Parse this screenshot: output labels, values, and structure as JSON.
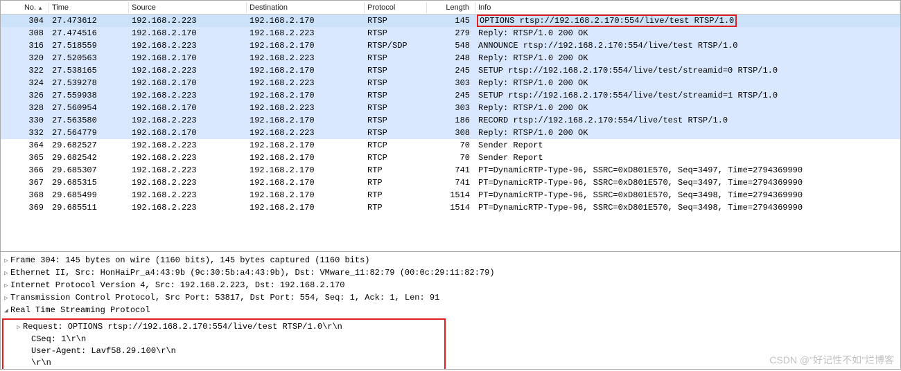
{
  "headers": {
    "no": "No.",
    "time": "Time",
    "source": "Source",
    "dest": "Destination",
    "proto": "Protocol",
    "len": "Length",
    "info": "Info"
  },
  "packets": [
    {
      "no": "304",
      "time": "27.473612",
      "src": "192.168.2.223",
      "dst": "192.168.2.170",
      "proto": "RTSP",
      "len": "145",
      "info": "OPTIONS rtsp://192.168.2.170:554/live/test RTSP/1.0",
      "selected": true,
      "boxed": true
    },
    {
      "no": "308",
      "time": "27.474516",
      "src": "192.168.2.170",
      "dst": "192.168.2.223",
      "proto": "RTSP",
      "len": "279",
      "info": "Reply: RTSP/1.0 200 OK"
    },
    {
      "no": "316",
      "time": "27.518559",
      "src": "192.168.2.223",
      "dst": "192.168.2.170",
      "proto": "RTSP/SDP",
      "len": "548",
      "info": "ANNOUNCE rtsp://192.168.2.170:554/live/test RTSP/1.0"
    },
    {
      "no": "320",
      "time": "27.520563",
      "src": "192.168.2.170",
      "dst": "192.168.2.223",
      "proto": "RTSP",
      "len": "248",
      "info": "Reply: RTSP/1.0 200 OK"
    },
    {
      "no": "322",
      "time": "27.538165",
      "src": "192.168.2.223",
      "dst": "192.168.2.170",
      "proto": "RTSP",
      "len": "245",
      "info": "SETUP rtsp://192.168.2.170:554/live/test/streamid=0 RTSP/1.0"
    },
    {
      "no": "324",
      "time": "27.539278",
      "src": "192.168.2.170",
      "dst": "192.168.2.223",
      "proto": "RTSP",
      "len": "303",
      "info": "Reply: RTSP/1.0 200 OK"
    },
    {
      "no": "326",
      "time": "27.559938",
      "src": "192.168.2.223",
      "dst": "192.168.2.170",
      "proto": "RTSP",
      "len": "245",
      "info": "SETUP rtsp://192.168.2.170:554/live/test/streamid=1 RTSP/1.0"
    },
    {
      "no": "328",
      "time": "27.560954",
      "src": "192.168.2.170",
      "dst": "192.168.2.223",
      "proto": "RTSP",
      "len": "303",
      "info": "Reply: RTSP/1.0 200 OK"
    },
    {
      "no": "330",
      "time": "27.563580",
      "src": "192.168.2.223",
      "dst": "192.168.2.170",
      "proto": "RTSP",
      "len": "186",
      "info": "RECORD rtsp://192.168.2.170:554/live/test RTSP/1.0"
    },
    {
      "no": "332",
      "time": "27.564779",
      "src": "192.168.2.170",
      "dst": "192.168.2.223",
      "proto": "RTSP",
      "len": "308",
      "info": "Reply: RTSP/1.0 200 OK"
    },
    {
      "no": "364",
      "time": "29.682527",
      "src": "192.168.2.223",
      "dst": "192.168.2.170",
      "proto": "RTCP",
      "len": "70",
      "info": "Sender Report"
    },
    {
      "no": "365",
      "time": "29.682542",
      "src": "192.168.2.223",
      "dst": "192.168.2.170",
      "proto": "RTCP",
      "len": "70",
      "info": "Sender Report"
    },
    {
      "no": "366",
      "time": "29.685307",
      "src": "192.168.2.223",
      "dst": "192.168.2.170",
      "proto": "RTP",
      "len": "741",
      "info": "PT=DynamicRTP-Type-96, SSRC=0xD801E570, Seq=3497, Time=2794369990"
    },
    {
      "no": "367",
      "time": "29.685315",
      "src": "192.168.2.223",
      "dst": "192.168.2.170",
      "proto": "RTP",
      "len": "741",
      "info": "PT=DynamicRTP-Type-96, SSRC=0xD801E570, Seq=3497, Time=2794369990"
    },
    {
      "no": "368",
      "time": "29.685499",
      "src": "192.168.2.223",
      "dst": "192.168.2.170",
      "proto": "RTP",
      "len": "1514",
      "info": "PT=DynamicRTP-Type-96, SSRC=0xD801E570, Seq=3498, Time=2794369990"
    },
    {
      "no": "369",
      "time": "29.685511",
      "src": "192.168.2.223",
      "dst": "192.168.2.170",
      "proto": "RTP",
      "len": "1514",
      "info": "PT=DynamicRTP-Type-96, SSRC=0xD801E570, Seq=3498, Time=2794369990"
    }
  ],
  "details": {
    "frame": "Frame 304: 145 bytes on wire (1160 bits), 145 bytes captured (1160 bits)",
    "eth": "Ethernet II, Src: HonHaiPr_a4:43:9b (9c:30:5b:a4:43:9b), Dst: VMware_11:82:79 (00:0c:29:11:82:79)",
    "ip": "Internet Protocol Version 4, Src: 192.168.2.223, Dst: 192.168.2.170",
    "tcp": "Transmission Control Protocol, Src Port: 53817, Dst Port: 554, Seq: 1, Ack: 1, Len: 91",
    "rtsp": "Real Time Streaming Protocol",
    "request": "Request: OPTIONS rtsp://192.168.2.170:554/live/test RTSP/1.0\\r\\n",
    "cseq": "CSeq: 1\\r\\n",
    "ua": "User-Agent: Lavf58.29.100\\r\\n",
    "crlf": "\\r\\n"
  },
  "watermark": "CSDN @\"好记性不如\"烂博客"
}
